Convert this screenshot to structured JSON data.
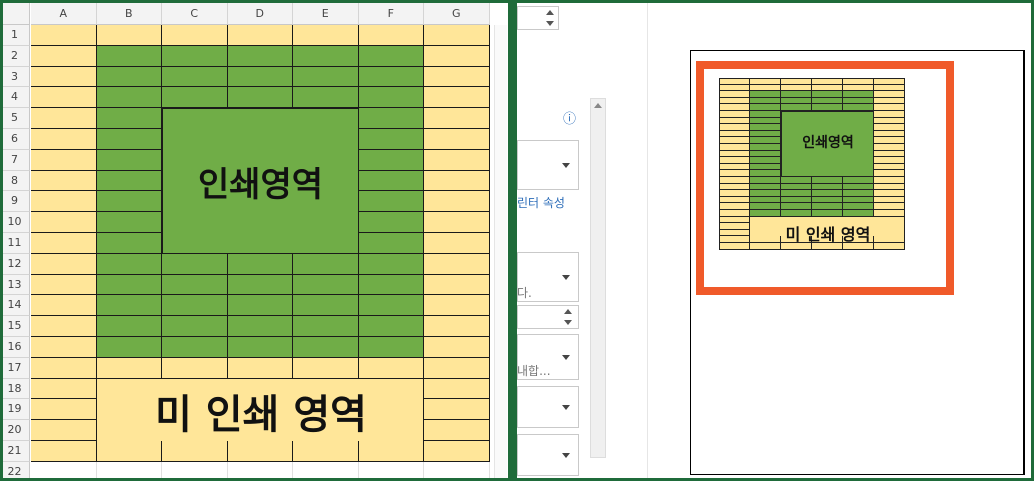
{
  "sheet": {
    "columns": [
      "A",
      "B",
      "C",
      "D",
      "E",
      "F",
      "G"
    ],
    "rows": [
      "1",
      "2",
      "3",
      "4",
      "5",
      "6",
      "7",
      "8",
      "9",
      "10",
      "11",
      "12",
      "13",
      "14",
      "15",
      "16",
      "17",
      "18",
      "19",
      "20",
      "21",
      "22"
    ],
    "print_area_label": "인쇄영역",
    "non_print_area_label": "미 인쇄 영역"
  },
  "print_settings": {
    "info_icon": "ⓘ",
    "printer_properties_link": "린터 속성",
    "truncated_text_1": "다.",
    "truncated_text_2": "내합..."
  },
  "preview": {
    "print_area_label": "인쇄영역",
    "non_print_area_label": "미 인쇄 영역"
  },
  "colors": {
    "print_area": "#70ad47",
    "non_print_area": "#ffe699",
    "highlight": "#f05a2a",
    "divider": "#1f6b3a"
  }
}
